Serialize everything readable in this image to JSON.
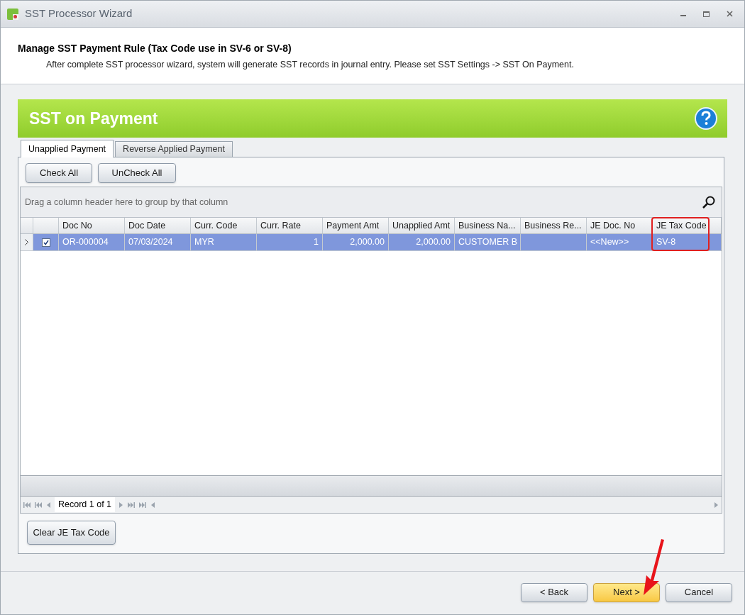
{
  "window": {
    "title": "SST Processor Wizard"
  },
  "header": {
    "title": "Manage SST Payment Rule (Tax Code use in SV-6 or SV-8)",
    "description": "After complete SST processor wizard, system will generate SST records in journal entry. Please set SST Settings -> SST On Payment."
  },
  "banner": {
    "title": "SST on Payment"
  },
  "tabs": [
    {
      "label": "Unapplied Payment",
      "selected": true
    },
    {
      "label": "Reverse Applied Payment",
      "selected": false
    }
  ],
  "toolbar_buttons": [
    "Check All",
    "UnCheck All"
  ],
  "grid": {
    "group_hint": "Drag a column header here to group by that column",
    "columns": [
      {
        "label": "Doc No",
        "kind": "text"
      },
      {
        "label": "Doc Date",
        "kind": "text"
      },
      {
        "label": "Curr. Code",
        "kind": "text"
      },
      {
        "label": "Curr. Rate",
        "kind": "number"
      },
      {
        "label": "Payment Amt",
        "kind": "number"
      },
      {
        "label": "Unapplied Amt",
        "kind": "number"
      },
      {
        "label": "Business Na...",
        "kind": "text"
      },
      {
        "label": "Business Re...",
        "kind": "text"
      },
      {
        "label": "JE Doc. No",
        "kind": "text"
      },
      {
        "label": "JE Tax Code",
        "kind": "text"
      }
    ],
    "rows": [
      {
        "selected": true,
        "checked": true,
        "cells": [
          "OR-000004",
          "07/03/2024",
          "MYR",
          "1",
          "2,000.00",
          "2,000.00",
          "CUSTOMER B",
          "",
          "<<New>>",
          "SV-8"
        ]
      }
    ],
    "navigator": {
      "record": "Record 1 of 1"
    }
  },
  "panel_button": "Clear JE Tax Code",
  "footer_buttons": [
    {
      "label": "< Back",
      "kind": "normal"
    },
    {
      "label": "Next >",
      "kind": "default"
    },
    {
      "label": "Cancel",
      "kind": "normal"
    }
  ]
}
